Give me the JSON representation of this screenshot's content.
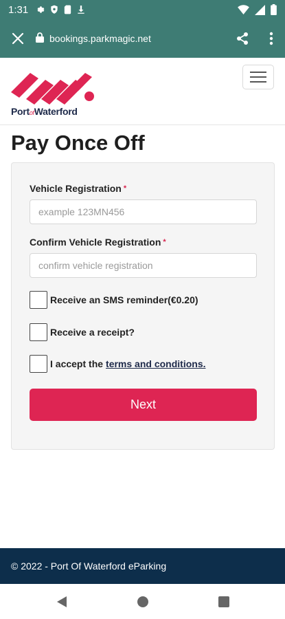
{
  "status_bar": {
    "time": "1:31",
    "left_icons": [
      "gear-icon",
      "shield-icon",
      "sim-card-icon",
      "download-icon"
    ],
    "right_icons": [
      "wifi-icon",
      "signal-icon",
      "battery-icon"
    ]
  },
  "browser": {
    "url": "bookings.parkmagic.net",
    "close_icon": "close-icon",
    "lock_icon": "lock-icon",
    "share_icon": "share-icon",
    "menu_icon": "more-vert-icon"
  },
  "header": {
    "logo_text_before": "Port",
    "logo_text_of": "of",
    "logo_text_after": "Waterford",
    "menu_icon": "hamburger-icon",
    "brand_color": "#de2553",
    "navy_color": "#1e2a4a"
  },
  "page": {
    "title": "Pay Once Off"
  },
  "form": {
    "vehicle_reg_label": "Vehicle Registration",
    "vehicle_reg_required": "*",
    "vehicle_reg_placeholder": "example 123MN456",
    "vehicle_reg_value": "",
    "confirm_reg_label": "Confirm Vehicle Registration",
    "confirm_reg_required": "*",
    "confirm_reg_placeholder": "confirm vehicle registration",
    "confirm_reg_value": "",
    "sms_label": "Receive an SMS reminder(€0.20)",
    "receipt_label": "Receive a receipt?",
    "terms_prefix": "I accept the",
    "terms_link": "terms and conditions.",
    "next_label": "Next",
    "sms_checked": false,
    "receipt_checked": false,
    "terms_checked": false
  },
  "footer": {
    "text": "© 2022 - Port Of Waterford eParking",
    "background": "#0d2e4b"
  },
  "nav_bar": {
    "icons": [
      "back-icon",
      "home-icon",
      "recents-icon"
    ]
  }
}
